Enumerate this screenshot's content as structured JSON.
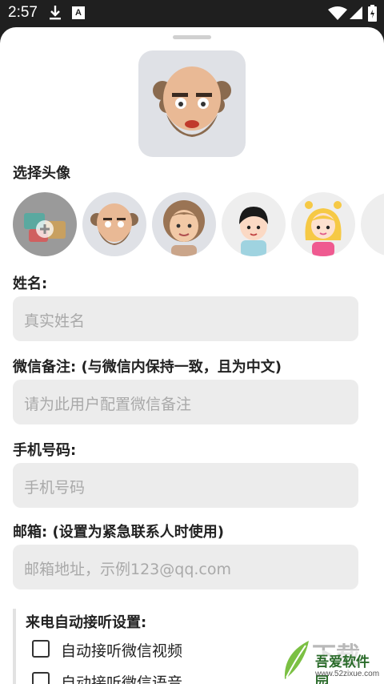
{
  "status_bar": {
    "time": "2:57"
  },
  "sheet": {
    "choose_avatar_label": "选择头像",
    "avatars": [
      {
        "name": "add-photo",
        "selected": true
      },
      {
        "name": "bald-man"
      },
      {
        "name": "grandma"
      },
      {
        "name": "boy"
      },
      {
        "name": "girl"
      },
      {
        "name": "more"
      }
    ],
    "fields": [
      {
        "label": "姓名:",
        "placeholder": "真实姓名"
      },
      {
        "label": "微信备注: (与微信内保持一致，且为中文)",
        "placeholder": "请为此用户配置微信备注"
      },
      {
        "label": "手机号码:",
        "placeholder": "手机号码"
      },
      {
        "label": "邮箱: (设置为紧急联系人时使用)",
        "placeholder": "邮箱地址，示例123@qq.com"
      }
    ],
    "auto_answer": {
      "title": "来电自动接听设置:",
      "options": [
        {
          "label": "自动接听微信视频",
          "checked": false
        },
        {
          "label": "自动接听微信语音",
          "checked": false
        }
      ]
    }
  },
  "watermark": {
    "big": "下载",
    "title": "吾爱软件园",
    "url": "www.52zixue.com"
  }
}
